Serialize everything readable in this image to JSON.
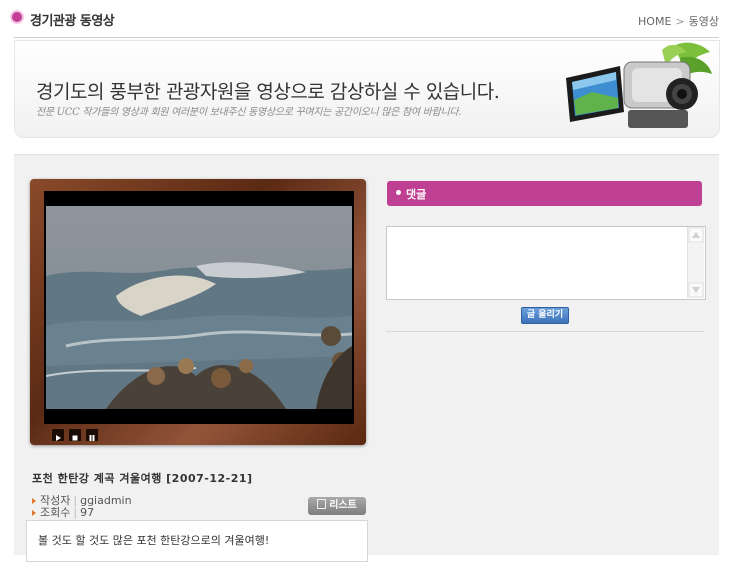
{
  "header": {
    "title": "경기관광 동영상",
    "breadcrumb": {
      "home": "HOME",
      "separator": ">",
      "current": "동영상"
    }
  },
  "banner": {
    "main_text": "경기도의 풍부한 관광자원을 영상으로 감상하실 수 있습니다.",
    "sub_text": "전문 UCC 작가들의 영상과 회원 여러분이 보내주신 동영상으로 꾸며지는 공간이오니 많은 참여 바랍니다."
  },
  "video": {
    "title": "포천 한탄강 계곡 겨울여행 [2007-12-21]",
    "author_label": "작성자",
    "author": "ggiadmin",
    "views_label": "조회수",
    "views": "97",
    "list_button": "리스트",
    "description": "볼 것도 할 것도 많은 포천 한탄강으로의 겨울여행!"
  },
  "comments": {
    "header": "댓글",
    "submit_button": "글 올리기"
  },
  "colors": {
    "accent_pink": "#bf3f92",
    "button_blue": "#3c73b9"
  }
}
